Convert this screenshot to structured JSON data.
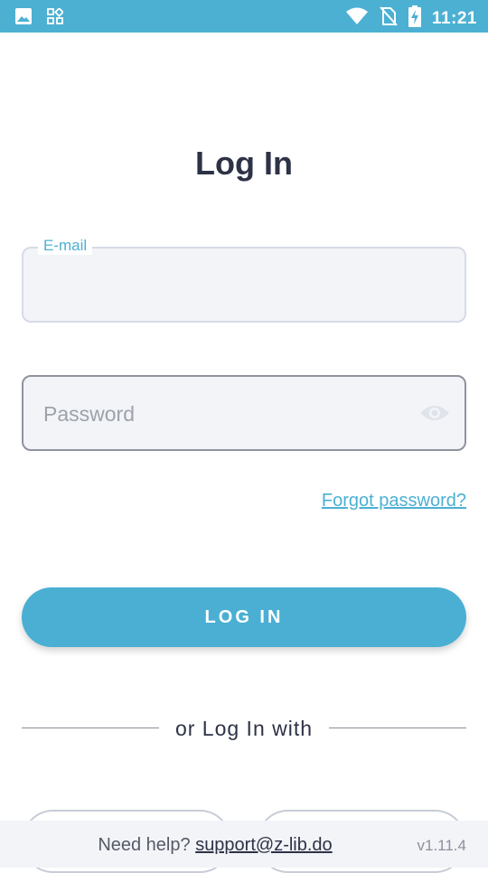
{
  "status_bar": {
    "time": "11:21",
    "icons": [
      "image-icon",
      "widgets-icon",
      "wifi-icon",
      "no-sim-icon",
      "battery-charging-icon"
    ]
  },
  "title": "Log In",
  "email_field": {
    "label": "E-mail",
    "value": ""
  },
  "password_field": {
    "placeholder": "Password",
    "value": ""
  },
  "forgot_password": "Forgot password?",
  "login_button": "LOG IN",
  "divider_text": "or Log In with",
  "footer": {
    "help_prefix": "Need help?",
    "help_email": "support@z-lib.do",
    "version": "v1.11.4"
  },
  "colors": {
    "accent": "#4cb0d3",
    "text_dark": "#2d3246",
    "field_bg": "#f2f4f8"
  }
}
